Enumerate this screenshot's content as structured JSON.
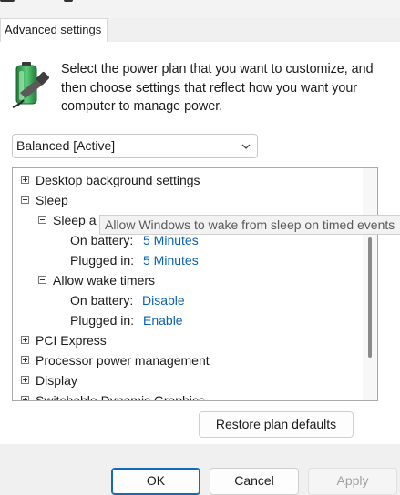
{
  "tabs": [
    {
      "label": "Advanced settings"
    }
  ],
  "intro_text": "Select the power plan that you want to customize, and then choose settings that reflect how you want your computer to manage power.",
  "plan_select": {
    "value": "Balanced [Active]"
  },
  "tree": {
    "desktop_background": "Desktop background settings",
    "sleep": "Sleep",
    "sleep_after_partial": "Sleep a",
    "sleep_after": {
      "on_battery_label": "On battery:",
      "on_battery_value": "5 Minutes",
      "plugged_in_label": "Plugged in:",
      "plugged_in_value": "5 Minutes"
    },
    "wake_timers": "Allow wake timers",
    "wake": {
      "on_battery_label": "On battery:",
      "on_battery_value": "Disable",
      "plugged_in_label": "Plugged in:",
      "plugged_in_value": "Enable"
    },
    "pci_express": "PCI Express",
    "processor": "Processor power management",
    "display": "Display",
    "switchable": "Switchable Dynamic Graphics"
  },
  "tooltip": "Allow Windows to wake from sleep on timed events",
  "restore_button": "Restore plan defaults",
  "buttons": {
    "ok": "OK",
    "cancel": "Cancel",
    "apply": "Apply"
  },
  "colors": {
    "link": "#0b61b5",
    "accent": "#0f6cbd",
    "battery_green": "#2fa84f"
  },
  "icons": {
    "battery": "battery-plug-icon",
    "dropdown": "chevron-down-icon",
    "expand": "plus-box-icon",
    "collapse": "minus-box-icon"
  }
}
